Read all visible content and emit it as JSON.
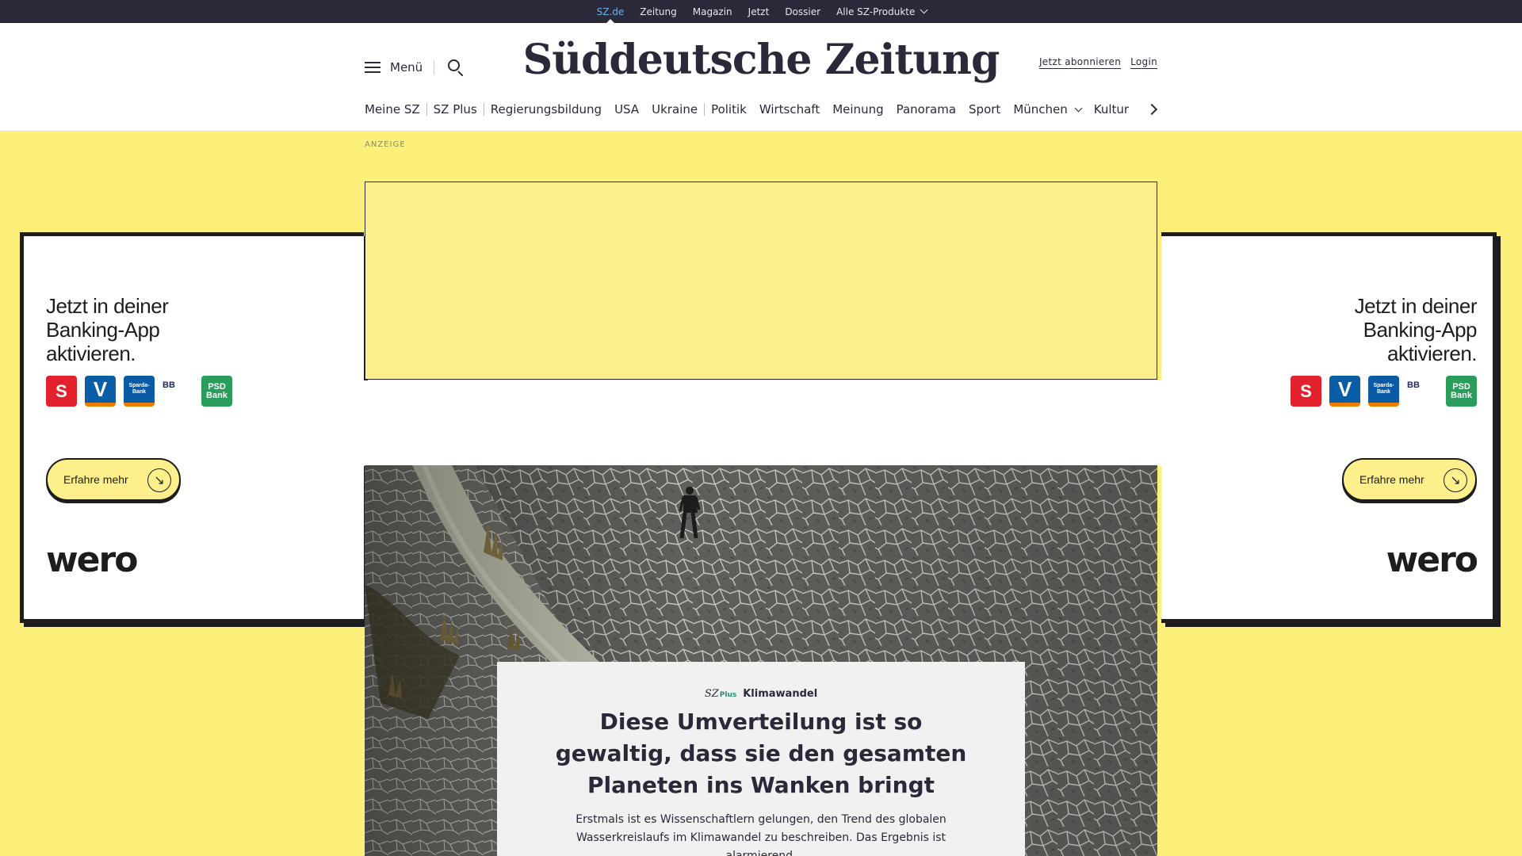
{
  "topbar": {
    "items": [
      "SZ.de",
      "Zeitung",
      "Magazin",
      "Jetzt",
      "Dossier",
      "Alle SZ-Produkte"
    ]
  },
  "header": {
    "menu_label": "Menü",
    "logo": "Süddeutsche Zeitung",
    "subscribe": "Jetzt abonnieren",
    "login": "Login"
  },
  "nav": {
    "items": [
      "Meine SZ",
      "SZ Plus",
      "Regierungsbildung",
      "USA",
      "Ukraine",
      "Politik",
      "Wirtschaft",
      "Meinung",
      "Panorama",
      "Sport",
      "München",
      "Kultur"
    ]
  },
  "ad": {
    "label": "ANZEIGE",
    "headline_line1": "Jetzt in deiner",
    "headline_line2": "Banking-App",
    "headline_line3": "aktivieren.",
    "cta": "Erfahre mehr",
    "brand": "wero",
    "banks": {
      "spk": "S",
      "vr": "V",
      "sparda": "Sparda-Bank",
      "bb": "BB",
      "psd": "PSD Bank"
    }
  },
  "article": {
    "brand": "SZ",
    "brand_plus": "Plus",
    "kicker": "Klimawandel",
    "headline": "Diese Umverteilung ist so gewaltig, dass sie den gesamten Planeten ins Wanken bringt",
    "lead": "Erstmals ist es Wissenschaftlern gelungen, den Trend des globalen Wasserkreislaufs im Klimawandel zu beschreiben. Das Ergebnis ist alarmierend."
  },
  "colors": {
    "page_bg": "#fdf07a",
    "topbar_bg": "#29293a",
    "active_link": "#6fb1e8",
    "szplus_accent": "#2a8b6f"
  }
}
